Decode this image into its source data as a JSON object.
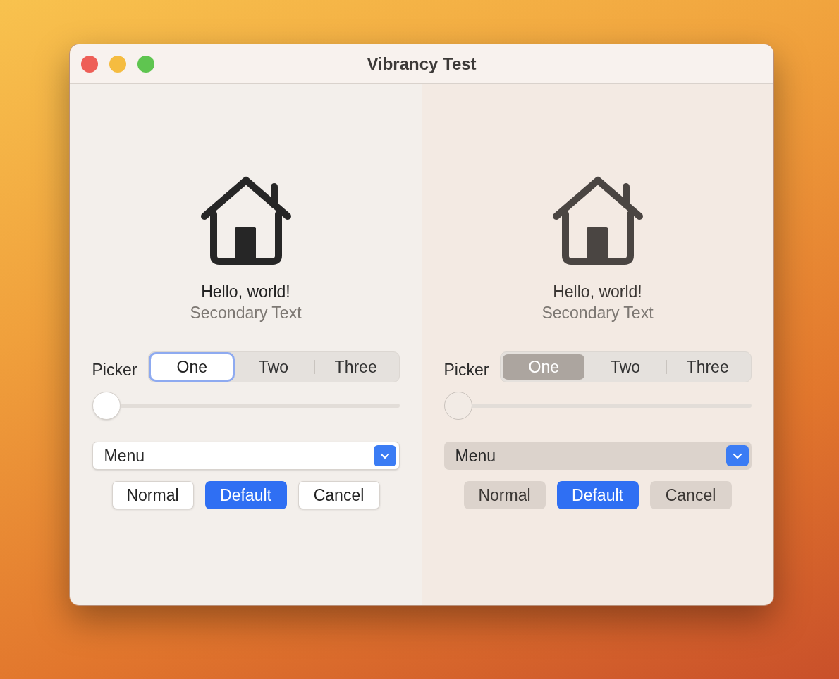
{
  "window": {
    "title": "Vibrancy Test"
  },
  "panes": [
    {
      "kind": "plain",
      "greeting": "Hello, world!",
      "secondary": "Secondary Text",
      "picker": {
        "label": "Picker",
        "segments": [
          {
            "label": "One",
            "selected": true
          },
          {
            "label": "Two",
            "selected": false
          },
          {
            "label": "Three",
            "selected": false
          }
        ]
      },
      "slider": {
        "level": 0
      },
      "menu": {
        "value": "Menu"
      },
      "buttons": [
        {
          "label": "Normal",
          "kind": "normal"
        },
        {
          "label": "Default",
          "kind": "default"
        },
        {
          "label": "Cancel",
          "kind": "normal"
        }
      ]
    },
    {
      "kind": "vibrant",
      "greeting": "Hello, world!",
      "secondary": "Secondary Text",
      "picker": {
        "label": "Picker",
        "segments": [
          {
            "label": "One",
            "selected": true
          },
          {
            "label": "Two",
            "selected": false
          },
          {
            "label": "Three",
            "selected": false
          }
        ]
      },
      "slider": {
        "level": 0
      },
      "menu": {
        "value": "Menu"
      },
      "buttons": [
        {
          "label": "Normal",
          "kind": "normal"
        },
        {
          "label": "Default",
          "kind": "default"
        },
        {
          "label": "Cancel",
          "kind": "normal"
        }
      ]
    }
  ]
}
